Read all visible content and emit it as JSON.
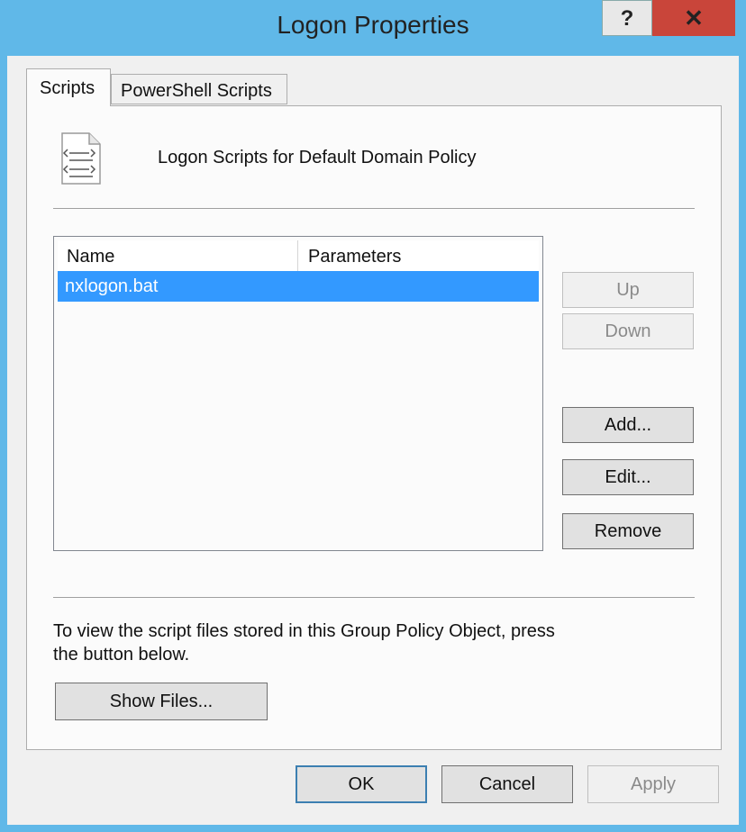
{
  "window": {
    "title": "Logon Properties",
    "help_label": "?",
    "close_label": "✕"
  },
  "tabs": [
    {
      "label": "Scripts",
      "active": true
    },
    {
      "label": "PowerShell Scripts",
      "active": false
    }
  ],
  "panel": {
    "heading": "Logon Scripts for Default Domain Policy",
    "icon": "script-file-icon"
  },
  "list": {
    "columns": [
      "Name",
      "Parameters"
    ],
    "rows": [
      {
        "name": "nxlogon.bat",
        "parameters": "",
        "selected": true
      }
    ]
  },
  "side_buttons": {
    "up": "Up",
    "down": "Down",
    "add": "Add...",
    "edit": "Edit...",
    "remove": "Remove"
  },
  "info_text": {
    "line1": "To view the script files stored in this Group Policy Object, press",
    "line2": "the button below."
  },
  "show_files_label": "Show Files...",
  "footer": {
    "ok": "OK",
    "cancel": "Cancel",
    "apply": "Apply"
  },
  "colors": {
    "frame": "#60b8e8",
    "close": "#c9453a",
    "selection": "#3399ff"
  }
}
